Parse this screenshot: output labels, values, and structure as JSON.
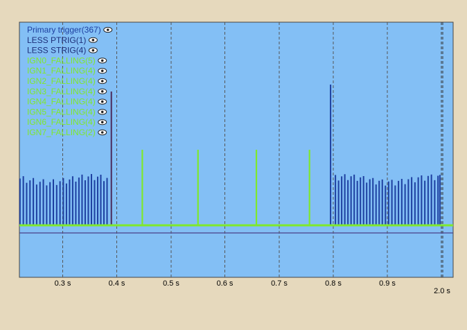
{
  "chart_data": {
    "type": "line",
    "title": "",
    "xlabel": "",
    "ylabel": "",
    "x_unit": "s",
    "xlim": [
      0.225,
      2.021
    ],
    "x_ticks": [
      {
        "value": 0.3,
        "label": "0.3 s"
      },
      {
        "value": 0.4,
        "label": "0.4 s"
      },
      {
        "value": 0.5,
        "label": "0.5 s"
      },
      {
        "value": 0.6,
        "label": "0.6 s"
      },
      {
        "value": 0.7,
        "label": "0.7 s"
      },
      {
        "value": 0.8,
        "label": "0.8 s"
      },
      {
        "value": 0.9,
        "label": "0.9 s"
      }
    ],
    "x_tick_end": {
      "value": 2.0,
      "label": "2.0 s"
    },
    "grid": "vertical dashed",
    "legend_placement": "top-left",
    "colors": {
      "plot_background": "#83bff5",
      "page_background": "#e6d9bd",
      "primary": "#1d3fa0",
      "less": "#1d2f7a",
      "ign": "#7fe82c",
      "grid": "#555555"
    },
    "legend": [
      {
        "label": "Primary trigger(367)",
        "color": "#1d3fa0"
      },
      {
        "label": "LESS PTRIG(1)",
        "color": "#1d2f7a"
      },
      {
        "label": "LESS STRIG(4)",
        "color": "#1d2f7a"
      },
      {
        "label": "IGN0_FALLING(5)",
        "color": "#7fe82c"
      },
      {
        "label": "IGN1_FALLING(4)",
        "color": "#7fe82c"
      },
      {
        "label": "IGN2_FALLING(4)",
        "color": "#7fe82c"
      },
      {
        "label": "IGN3_FALLING(4)",
        "color": "#7fe82c"
      },
      {
        "label": "IGN4_FALLING(4)",
        "color": "#7fe82c"
      },
      {
        "label": "IGN5_FALLING(4)",
        "color": "#7fe82c"
      },
      {
        "label": "IGN6_FALLING(4)",
        "color": "#7fe82c"
      },
      {
        "label": "IGN7_FALLING(2)",
        "color": "#7fe82c"
      }
    ],
    "primary_pulses": {
      "x_start": 0.226,
      "x_end": 0.999,
      "gap": [
        0.385,
        0.8
      ],
      "long_pulses": [
        0.39,
        0.795
      ]
    },
    "ign_pulses": [
      0.447,
      0.55,
      0.658,
      0.756
    ],
    "marker_line_x": 1.0
  }
}
